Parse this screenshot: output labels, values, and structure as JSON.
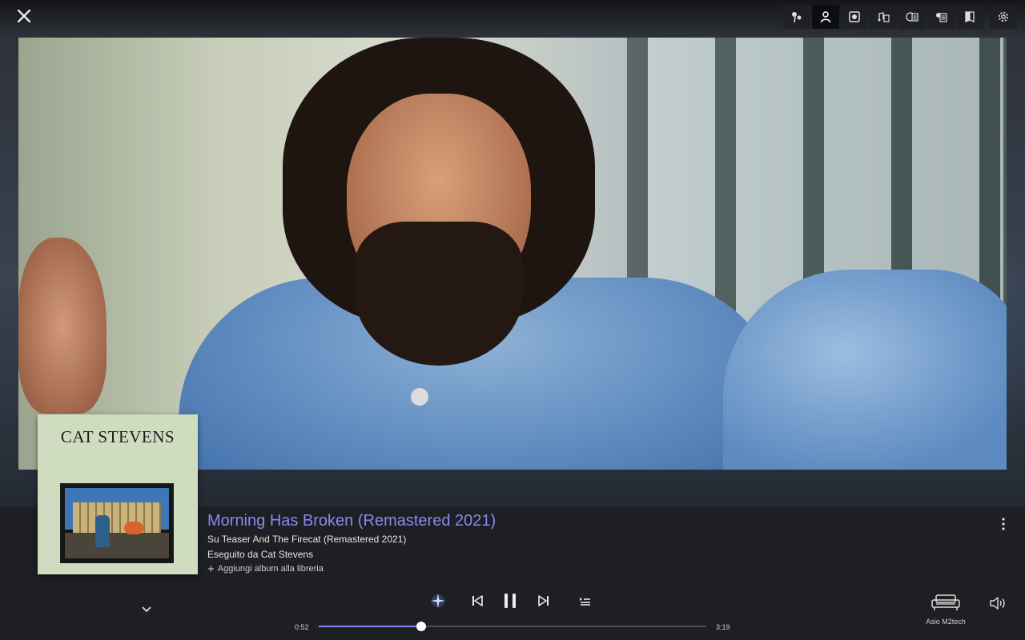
{
  "header": {
    "close_icon": "close-icon",
    "toolbar": [
      {
        "name": "visualizer-icon",
        "active": false
      },
      {
        "name": "artist-icon",
        "active": true
      },
      {
        "name": "album-art-icon",
        "active": false
      },
      {
        "name": "lyrics-icon",
        "active": false
      },
      {
        "name": "album-review-icon",
        "active": false
      },
      {
        "name": "artist-bio-icon",
        "active": false
      },
      {
        "name": "booklet-icon",
        "active": false
      },
      {
        "name": "settings-icon",
        "active": false
      }
    ]
  },
  "cover": {
    "title": "CAT STEVENS"
  },
  "track": {
    "title": "Morning Has Broken (Remastered 2021)",
    "album": "Su Teaser And The Firecat (Remastered 2021)",
    "artist": "Eseguito da Cat Stevens",
    "add_to_library": "Aggiungi album alla libreria"
  },
  "player": {
    "elapsed": "0:52",
    "duration": "3:19",
    "progress": 0.2638,
    "accent": "#8e86f2"
  },
  "device": {
    "label": "Asio M2tech"
  }
}
